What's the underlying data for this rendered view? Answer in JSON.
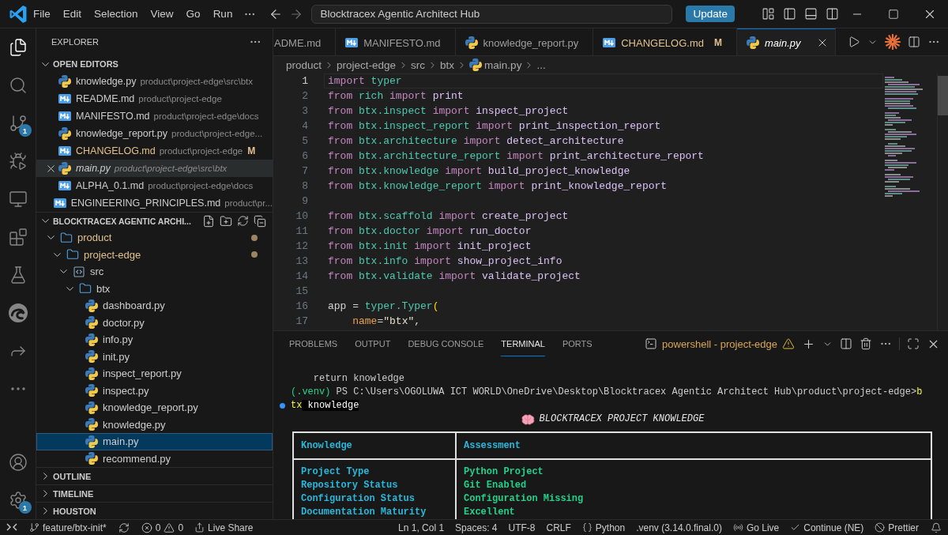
{
  "title_bar": {
    "menu": [
      "File",
      "Edit",
      "Selection",
      "View",
      "Go",
      "Run"
    ],
    "command_center": "Blocktracex Agentic Architect Hub",
    "update_button": "Update"
  },
  "activity_bar": {
    "items": [
      {
        "kind": "explorer",
        "selected": true
      },
      {
        "kind": "search",
        "selected": false
      },
      {
        "kind": "source_control",
        "selected": false,
        "badge": "1"
      },
      {
        "kind": "run_debug",
        "selected": false
      },
      {
        "kind": "remote",
        "selected": false
      },
      {
        "kind": "extensions",
        "selected": false
      },
      {
        "kind": "testing",
        "selected": false
      },
      {
        "kind": "edge",
        "selected": false
      },
      {
        "kind": "live_share",
        "selected": false
      },
      {
        "kind": "more",
        "selected": false
      }
    ],
    "bottom": [
      {
        "kind": "account"
      },
      {
        "kind": "settings",
        "badge": "1"
      }
    ]
  },
  "sidebar": {
    "title": "EXPLORER",
    "open_editors": {
      "title": "OPEN EDITORS",
      "expanded": true,
      "items": [
        {
          "name": "knowledge.py",
          "path": "product\\project-edge\\src\\btx",
          "kind": "python",
          "selected": false,
          "preview": false
        },
        {
          "name": "README.md",
          "path": "product\\project-edge",
          "kind": "markdown",
          "selected": false,
          "preview": false
        },
        {
          "name": "MANIFESTO.md",
          "path": "product\\project-edge\\docs",
          "kind": "markdown",
          "selected": false,
          "preview": false
        },
        {
          "name": "knowledge_report.py",
          "path": "product\\project-edge...",
          "kind": "python",
          "selected": false,
          "preview": false
        },
        {
          "name": "CHANGELOG.md",
          "path": "product\\project-edge",
          "kind": "markdown",
          "selected": false,
          "preview": false,
          "git_status": "M"
        },
        {
          "name": "main.py",
          "path": "product\\project-edge\\src\\btx",
          "kind": "python",
          "selected": true,
          "preview": true
        },
        {
          "name": "ALPHA_0.1.md",
          "path": "product\\project-edge\\docs",
          "kind": "markdown",
          "selected": false,
          "preview": false
        },
        {
          "name": "ENGINEERING_PRINCIPLES.md",
          "path": "product\\pr...",
          "kind": "markdown",
          "selected": false,
          "preview": false
        }
      ]
    },
    "workspace": {
      "title": "BLOCKTRACEX AGENTIC ARCHI...",
      "expanded": true,
      "tree": [
        {
          "name": "product",
          "kind": "folder",
          "expanded": true,
          "modified": true,
          "selected": false,
          "children": [
            {
              "name": "project-edge",
              "kind": "folder",
              "expanded": true,
              "modified": true,
              "selected": false,
              "children": [
                {
                  "name": "src",
                  "kind": "code_folder",
                  "expanded": true,
                  "modified": false,
                  "selected": false,
                  "children": [
                    {
                      "name": "btx",
                      "kind": "folder",
                      "expanded": true,
                      "modified": false,
                      "selected": false,
                      "children": [
                        {
                          "name": "dashboard.py",
                          "kind": "python",
                          "selected": false
                        },
                        {
                          "name": "doctor.py",
                          "kind": "python",
                          "selected": false
                        },
                        {
                          "name": "info.py",
                          "kind": "python",
                          "selected": false
                        },
                        {
                          "name": "init.py",
                          "kind": "python",
                          "selected": false
                        },
                        {
                          "name": "inspect_report.py",
                          "kind": "python",
                          "selected": false
                        },
                        {
                          "name": "inspect.py",
                          "kind": "python",
                          "selected": false
                        },
                        {
                          "name": "knowledge_report.py",
                          "kind": "python",
                          "selected": false
                        },
                        {
                          "name": "knowledge.py",
                          "kind": "python",
                          "selected": false
                        },
                        {
                          "name": "main.py",
                          "kind": "python",
                          "selected": true
                        },
                        {
                          "name": "recommend.py",
                          "kind": "python",
                          "selected": false
                        }
                      ]
                    }
                  ]
                }
              ]
            }
          ]
        }
      ]
    },
    "sections": [
      {
        "title": "OUTLINE",
        "expanded": false
      },
      {
        "title": "TIMELINE",
        "expanded": false
      },
      {
        "title": "HOUSTON",
        "expanded": false
      }
    ]
  },
  "editor": {
    "tabs": [
      {
        "label": "ADME.md",
        "selected": false,
        "preview": false
      },
      {
        "label": "MANIFESTO.md",
        "kind": "markdown",
        "selected": false,
        "preview": false
      },
      {
        "label": "knowledge_report.py",
        "kind": "python",
        "selected": false,
        "preview": false
      },
      {
        "label": "CHANGELOG.md",
        "kind": "markdown",
        "selected": false,
        "preview": false,
        "git_status": "M"
      },
      {
        "label": "main.py",
        "kind": "python",
        "selected": true,
        "preview": true
      }
    ],
    "breadcrumbs": [
      {
        "label": "product"
      },
      {
        "label": "project-edge"
      },
      {
        "label": "src"
      },
      {
        "label": "btx"
      },
      {
        "label": "main.py",
        "kind": "python"
      },
      {
        "label": "..."
      }
    ],
    "lines": [
      {
        "number": "1",
        "current": true,
        "tokens": [
          {
            "kind": "keyword",
            "text": "import "
          },
          {
            "kind": "module",
            "text": "typer"
          }
        ]
      },
      {
        "number": "2",
        "current": false,
        "tokens": [
          {
            "kind": "keyword",
            "text": "from "
          },
          {
            "kind": "module",
            "text": "rich "
          },
          {
            "kind": "keyword",
            "text": "import "
          },
          {
            "kind": "name",
            "text": "print"
          }
        ]
      },
      {
        "number": "3",
        "current": false,
        "tokens": [
          {
            "kind": "keyword",
            "text": "from "
          },
          {
            "kind": "module",
            "text": "btx.inspect "
          },
          {
            "kind": "keyword",
            "text": "import "
          },
          {
            "kind": "name",
            "text": "inspect_project"
          }
        ]
      },
      {
        "number": "4",
        "current": false,
        "tokens": [
          {
            "kind": "keyword",
            "text": "from "
          },
          {
            "kind": "module",
            "text": "btx.inspect_report "
          },
          {
            "kind": "keyword",
            "text": "import "
          },
          {
            "kind": "name",
            "text": "print_inspection_report"
          }
        ]
      },
      {
        "number": "5",
        "current": false,
        "tokens": [
          {
            "kind": "keyword",
            "text": "from "
          },
          {
            "kind": "module",
            "text": "btx.architecture "
          },
          {
            "kind": "keyword",
            "text": "import "
          },
          {
            "kind": "name",
            "text": "detect_architecture"
          }
        ]
      },
      {
        "number": "6",
        "current": false,
        "tokens": [
          {
            "kind": "keyword",
            "text": "from "
          },
          {
            "kind": "module",
            "text": "btx.architecture_report "
          },
          {
            "kind": "keyword",
            "text": "import "
          },
          {
            "kind": "name",
            "text": "print_architecture_report"
          }
        ]
      },
      {
        "number": "7",
        "current": false,
        "tokens": [
          {
            "kind": "keyword",
            "text": "from "
          },
          {
            "kind": "module",
            "text": "btx.knowledge "
          },
          {
            "kind": "keyword",
            "text": "import "
          },
          {
            "kind": "name",
            "text": "build_project_knowledge"
          }
        ]
      },
      {
        "number": "8",
        "current": false,
        "tokens": [
          {
            "kind": "keyword",
            "text": "from "
          },
          {
            "kind": "module",
            "text": "btx.knowledge_report "
          },
          {
            "kind": "keyword",
            "text": "import "
          },
          {
            "kind": "name",
            "text": "print_knowledge_report"
          }
        ]
      },
      {
        "number": "9",
        "current": false
      },
      {
        "number": "10",
        "current": false,
        "tokens": [
          {
            "kind": "keyword",
            "text": "from "
          },
          {
            "kind": "module",
            "text": "btx.scaffold "
          },
          {
            "kind": "keyword",
            "text": "import "
          },
          {
            "kind": "name",
            "text": "create_project"
          }
        ]
      },
      {
        "number": "11",
        "current": false,
        "tokens": [
          {
            "kind": "keyword",
            "text": "from "
          },
          {
            "kind": "module",
            "text": "btx.doctor "
          },
          {
            "kind": "keyword",
            "text": "import "
          },
          {
            "kind": "name",
            "text": "run_doctor"
          }
        ]
      },
      {
        "number": "12",
        "current": false,
        "tokens": [
          {
            "kind": "keyword",
            "text": "from "
          },
          {
            "kind": "module",
            "text": "btx.init "
          },
          {
            "kind": "keyword",
            "text": "import "
          },
          {
            "kind": "name",
            "text": "init_project"
          }
        ]
      },
      {
        "number": "13",
        "current": false,
        "tokens": [
          {
            "kind": "keyword",
            "text": "from "
          },
          {
            "kind": "module",
            "text": "btx.info "
          },
          {
            "kind": "keyword",
            "text": "import "
          },
          {
            "kind": "name",
            "text": "show_project_info"
          }
        ]
      },
      {
        "number": "14",
        "current": false,
        "tokens": [
          {
            "kind": "keyword",
            "text": "from "
          },
          {
            "kind": "module",
            "text": "btx.validate "
          },
          {
            "kind": "keyword",
            "text": "import "
          },
          {
            "kind": "name",
            "text": "validate_project"
          }
        ]
      },
      {
        "number": "15",
        "current": false
      },
      {
        "number": "16",
        "current": false,
        "tokens": [
          {
            "kind": "variable",
            "text": "app"
          },
          {
            "kind": "operator",
            "text": " = "
          },
          {
            "kind": "module",
            "text": "typer.Typer"
          },
          {
            "kind": "bracket",
            "text": "("
          }
        ]
      },
      {
        "number": "17",
        "current": false,
        "tokens": [
          {
            "kind": "param",
            "text": "    name"
          },
          {
            "kind": "operator",
            "text": "="
          },
          {
            "kind": "string",
            "text": "\"btx\""
          },
          {
            "kind": "operator",
            "text": ","
          }
        ]
      }
    ]
  },
  "panel": {
    "tabs": [
      {
        "label": "PROBLEMS",
        "selected": false
      },
      {
        "label": "OUTPUT",
        "selected": false
      },
      {
        "label": "DEBUG CONSOLE",
        "selected": false
      },
      {
        "label": "TERMINAL",
        "selected": true
      },
      {
        "label": "PORTS",
        "selected": false
      }
    ],
    "terminal_name": "powershell - project-edge",
    "terminal_warning": true,
    "terminal": {
      "lines": [
        {
          "marker": false,
          "segments": [
            {
              "kind": "output",
              "text": "    return knowledge"
            }
          ]
        },
        {
          "marker": false,
          "segments": [
            {
              "kind": "venv",
              "text": "(.venv)"
            },
            {
              "kind": "output",
              "text": " PS C:\\Users\\OGOLUWA ICT WORLD\\OneDrive\\Desktop\\Blocktracex Agentic Architect Hub\\product\\project-edge>"
            },
            {
              "kind": "command",
              "text": "b"
            }
          ]
        },
        {
          "marker": true,
          "segments": [
            {
              "kind": "command",
              "text": "tx"
            },
            {
              "kind": "argument",
              "text": " knowledge"
            }
          ]
        }
      ],
      "report_title": "BLOCKTRACEX PROJECT KNOWLEDGE",
      "table": {
        "columns": [
          "Knowledge",
          "Assessment"
        ],
        "rows": [
          [
            "Project Type",
            "Python Project"
          ],
          [
            "Repository Status",
            "Git Enabled"
          ],
          [
            "Configuration Status",
            "Configuration Missing"
          ],
          [
            "Documentation Maturity",
            "Excellent"
          ]
        ]
      }
    }
  },
  "status_bar": {
    "left": [
      {
        "kind": "remote"
      },
      {
        "kind": "branch",
        "text": "feature/btx-init*"
      },
      {
        "kind": "sync"
      },
      {
        "kind": "problems",
        "errors": "0",
        "warnings": "0"
      },
      {
        "kind": "live_share",
        "text": "Live Share"
      }
    ],
    "right": [
      {
        "kind": "text",
        "text": "Ln 1, Col 1"
      },
      {
        "kind": "text",
        "text": "Spaces: 4"
      },
      {
        "kind": "text",
        "text": "UTF-8"
      },
      {
        "kind": "text",
        "text": "CRLF"
      },
      {
        "kind": "language",
        "text": "Python"
      },
      {
        "kind": "text",
        "text": ".venv (3.14.0.final.0)"
      },
      {
        "kind": "go_live",
        "text": "Go Live"
      },
      {
        "kind": "continue",
        "text": "Continue (NE)"
      },
      {
        "kind": "prettier",
        "text": "Prettier"
      },
      {
        "kind": "notifications"
      }
    ]
  }
}
